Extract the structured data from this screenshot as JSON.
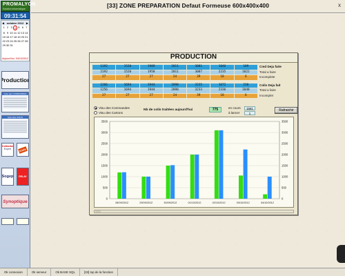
{
  "window": {
    "title": "[33]  ZONE PREPARATION Defaut Formeuse 600x400x400",
    "close_symbol": "x"
  },
  "sidebar": {
    "brand": "PROMALYON",
    "brand_sub": "Solution informatique",
    "clock": "09:31:54",
    "calendar": {
      "prev_symbol": "◀",
      "next_symbol": "▶",
      "month": "octobre 2012",
      "days": [
        "1",
        "2",
        "3",
        "4",
        "5",
        "6",
        "7",
        "8",
        "9",
        "10",
        "11",
        "12",
        "13",
        "14",
        "15",
        "16",
        "17",
        "18",
        "19",
        "20",
        "21",
        "22",
        "23",
        "24",
        "25",
        "26",
        "27",
        "28",
        "29",
        "30",
        "31"
      ],
      "today_day": "4",
      "today_label": "Aujourd'hui: 04/10/2012"
    },
    "production_label": "Production",
    "liste_title": "Liste des COMMANDES",
    "suivi_title": "Suivi des COLIS",
    "colissimo": [
      "Colissimo",
      "Expert"
    ],
    "kiala": "Kiala",
    "sogep": "Sogep",
    "relay": [
      "RELAY"
    ],
    "synoptique": "Synoptique"
  },
  "production": {
    "title": "PRODUCTION",
    "stats_rows": [
      {
        "values": [
          "1192",
          "1520",
          "1909",
          "2011",
          "3081",
          "1046",
          "189"
        ],
        "colors": [
          "#2f9fd8",
          "#2f9fd8",
          "#2f9fd8",
          "#2f9fd8",
          "#2f9fd8",
          "#2f9fd8",
          "#2f9fd8"
        ],
        "label": "Cmd Deja faite",
        "bold": true
      },
      {
        "values": [
          "2192",
          "1520",
          "1958",
          "2011",
          "3087",
          "2235",
          "1022"
        ],
        "colors": [
          "#a8cfe6",
          "#a8cfe6",
          "#a8cfe6",
          "#a8cfe6",
          "#a8cfe6",
          "#a8cfe6",
          "#a8cfe6"
        ],
        "label": "Total a faire",
        "bold": false
      },
      {
        "values": [
          "27",
          "27",
          "27",
          "24",
          "39",
          "18",
          "6"
        ],
        "colors": [
          "#e7a33a",
          "#e7a33a",
          "#e7a33a",
          "#e7a33a",
          "#e7a33a",
          "#e7a33a",
          "#e7a33a"
        ],
        "label": "Incomplete",
        "bold": false
      },
      {
        "values": [
          "1266",
          "1694",
          "1944",
          "2090",
          "3235",
          "1072",
          "230"
        ],
        "colors": [
          "#2f9fd8",
          "#2f9fd8",
          "#2f9fd8",
          "#2f9fd8",
          "#2f9fd8",
          "#2f9fd8",
          "#2f9fd8"
        ],
        "label": "Colis Deja fait",
        "bold": true
      },
      {
        "values": [
          "1256",
          "1694",
          "1944",
          "2090",
          "3233",
          "2336",
          "1048"
        ],
        "colors": [
          "#a8cfe6",
          "#a8cfe6",
          "#a8cfe6",
          "#a8cfe6",
          "#a8cfe6",
          "#a8cfe6",
          "#a8cfe6"
        ],
        "label": "Total a faire",
        "bold": false
      },
      {
        "values": [
          "27",
          "27",
          "27",
          "24",
          "39",
          "18",
          "6"
        ],
        "colors": [
          "#e7a33a",
          "#e7a33a",
          "#e7a33a",
          "#e7a33a",
          "#e7a33a",
          "#e7a33a",
          "#e7a33a"
        ],
        "label": "Incomplet",
        "bold": false
      }
    ],
    "radio_commandes": "Visu des Commandes",
    "radio_cartons": "Visu des Cartons",
    "colis_label": "Nb de colis traitées aujourd'hui",
    "colis_value": "775",
    "en_cours_label": "en cours",
    "en_cours_value": "1581",
    "a_lancer_label": "à lancer",
    "a_lancer_value": "1",
    "refresh_label": "Rafraichir"
  },
  "statusbar": [
    "Ok connexion",
    "Ok serveur",
    "Ok BASE SQL",
    "[33] top de la fonction"
  ],
  "colors": {
    "series_green": "#33dd11",
    "series_blue": "#2a8fff"
  },
  "chart_data": {
    "type": "bar",
    "categories": [
      "28/09/2012",
      "29/09/2012",
      "30/09/2012",
      "01/10/2012",
      "02/10/2012",
      "03/10/2012",
      "04/10/2012"
    ],
    "series": [
      {
        "color": "#33dd11",
        "values": [
          1192,
          1000,
          1500,
          2000,
          3100,
          1050,
          200
        ]
      },
      {
        "color": "#2a8fff",
        "values": [
          1200,
          1000,
          1520,
          2000,
          3100,
          2230,
          1000
        ]
      }
    ],
    "ylim": [
      0,
      3500
    ],
    "yticks": [
      "0",
      "500",
      "1000",
      "1500",
      "2000",
      "2500",
      "3000",
      "3500"
    ],
    "grid": true
  }
}
